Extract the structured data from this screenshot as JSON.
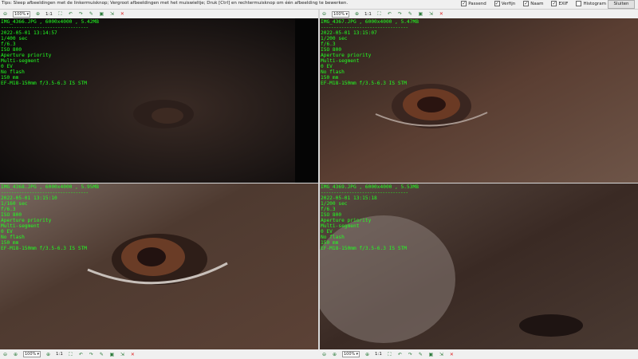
{
  "topbar": {
    "tip": "Tips: Sleep afbeeldingen met de linkermuisknop; Vergroot afbeeldingen met het muiswieltje; Druk [Ctrl] en rechtermuisknop om één afbeelding te bewerken.",
    "options": [
      {
        "label": "Passend",
        "checked": true
      },
      {
        "label": "Verfijn",
        "checked": true
      },
      {
        "label": "Naam",
        "checked": true
      },
      {
        "label": "EXIF",
        "checked": true
      },
      {
        "label": "Histogram",
        "checked": false
      }
    ],
    "close_label": "Sluiten"
  },
  "toolbar": {
    "zoom": "100%",
    "one_to_one": "1:1"
  },
  "panes": [
    {
      "header": "IMG_4366.JPG , 6000x4000 , 5.42MB",
      "sep": "----------------------------------",
      "lines": [
        "2022-05-01 13:14:57",
        "1/400 sec",
        "f/6.3",
        "ISO 800",
        "Aperture priority",
        "Multi-segment",
        "0 EV",
        "No flash",
        "150 mm",
        "EF-M18-150mm f/3.5-6.3 IS STM"
      ]
    },
    {
      "header": "IMG_4367.JPG , 6000x4000 , 5.47MB",
      "sep": "----------------------------------",
      "lines": [
        "2022-05-01 13:15:07",
        "1/200 sec",
        "f/6.3",
        "ISO 800",
        "Aperture priority",
        "Multi-segment",
        "0 EV",
        "No flash",
        "150 mm",
        "EF-M18-150mm f/3.5-6.3 IS STM"
      ]
    },
    {
      "header": "IMG_4368.JPG , 6000x4000 , 5.95MB",
      "sep": "----------------------------------",
      "lines": [
        "2022-05-01 13:15:10",
        "1/160 sec",
        "f/6.3",
        "ISO 800",
        "Aperture priority",
        "Multi-segment",
        "0 EV",
        "No flash",
        "150 mm",
        "EF-M18-150mm f/3.5-6.3 IS STM"
      ]
    },
    {
      "header": "IMG_4369.JPG , 6000x4000 , 5.53MB",
      "sep": "----------------------------------",
      "lines": [
        "2022-05-01 13:15:18",
        "1/200 sec",
        "f/6.3",
        "ISO 800",
        "Aperture priority",
        "Multi-segment",
        "0 EV",
        "No flash",
        "150 mm",
        "EF-M18-150mm f/3.5-6.3 IS STM"
      ]
    }
  ]
}
